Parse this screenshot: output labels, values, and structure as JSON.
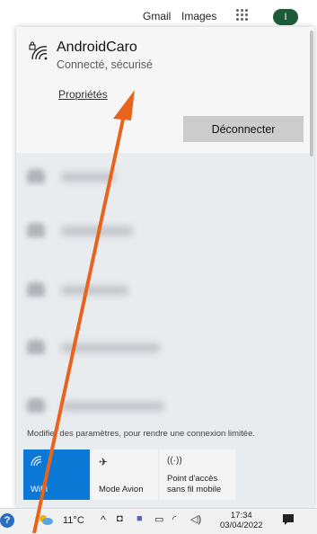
{
  "google_bar": {
    "gmail": "Gmail",
    "images": "Images",
    "avatar_letter": "I"
  },
  "connected_network": {
    "name": "AndroidCaro",
    "status": "Connecté, sécurisé",
    "properties_link": "Propriétés",
    "disconnect_button": "Déconnecter"
  },
  "other_networks_count": 5,
  "settings_text": "Modifier des paramètres, pour rendre une connexion limitée.",
  "tiles": [
    {
      "label": "WiFi",
      "icon": "wifi-icon",
      "active": true
    },
    {
      "label": "Mode Avion",
      "icon": "airplane-icon",
      "active": false
    },
    {
      "label": "Point d'accès sans fil mobile",
      "icon": "hotspot-icon",
      "active": false
    }
  ],
  "taskbar": {
    "temperature": "11°C",
    "time": "17:34",
    "date": "03/04/2022"
  },
  "colors": {
    "accent": "#0a78d4",
    "arrow": "#e8641c"
  }
}
